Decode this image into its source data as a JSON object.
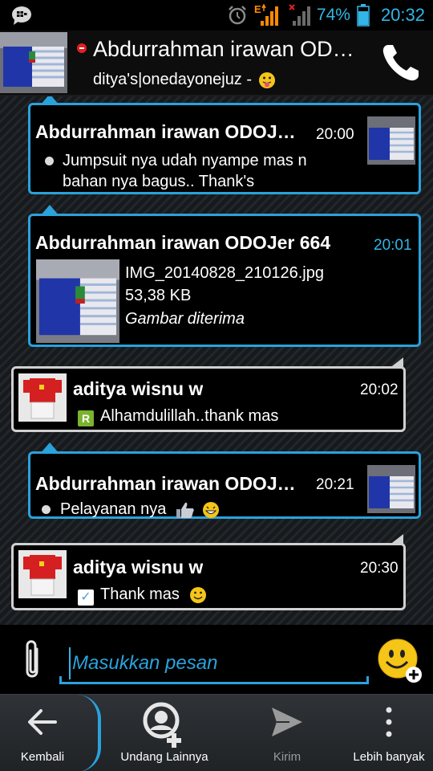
{
  "status_bar": {
    "network": "E",
    "battery_percent": "74%",
    "time": "20:32"
  },
  "header": {
    "title": "Abdurrahman irawan OD…",
    "subtitle": "ditya's|onedayonejuz -",
    "icons": [
      "do-not-disturb-icon",
      "phone-icon",
      "tongue-emoji-icon"
    ]
  },
  "messages": [
    {
      "sender": "Abdurrahman irawan ODOJ…",
      "time": "20:00",
      "text": "Jumpsuit nya udah nyampe mas n bahan nya bagus.. Thank's"
    },
    {
      "sender": "Abdurrahman irawan ODOJer 664",
      "time": "20:01",
      "file_name": "IMG_20140828_210126.jpg",
      "file_size": "53,38 KB",
      "file_status": "Gambar diterima"
    },
    {
      "sender": "aditya wisnu w",
      "time": "20:02",
      "text": "Alhamdulillah..thank mas"
    },
    {
      "sender": "Abdurrahman irawan ODOJ…",
      "time": "20:21",
      "text": "Pelayanan nya"
    },
    {
      "sender": "aditya wisnu w",
      "time": "20:30",
      "text": "Thank mas"
    }
  ],
  "input": {
    "placeholder": "Masukkan pesan"
  },
  "actions": {
    "back": "Kembali",
    "invite": "Undang Lainnya",
    "send": "Kirim",
    "more": "Lebih banyak"
  },
  "colors": {
    "accent": "#33b5e5",
    "sent_border": "#2aa2dc",
    "received_border": "#d0d0d0"
  }
}
